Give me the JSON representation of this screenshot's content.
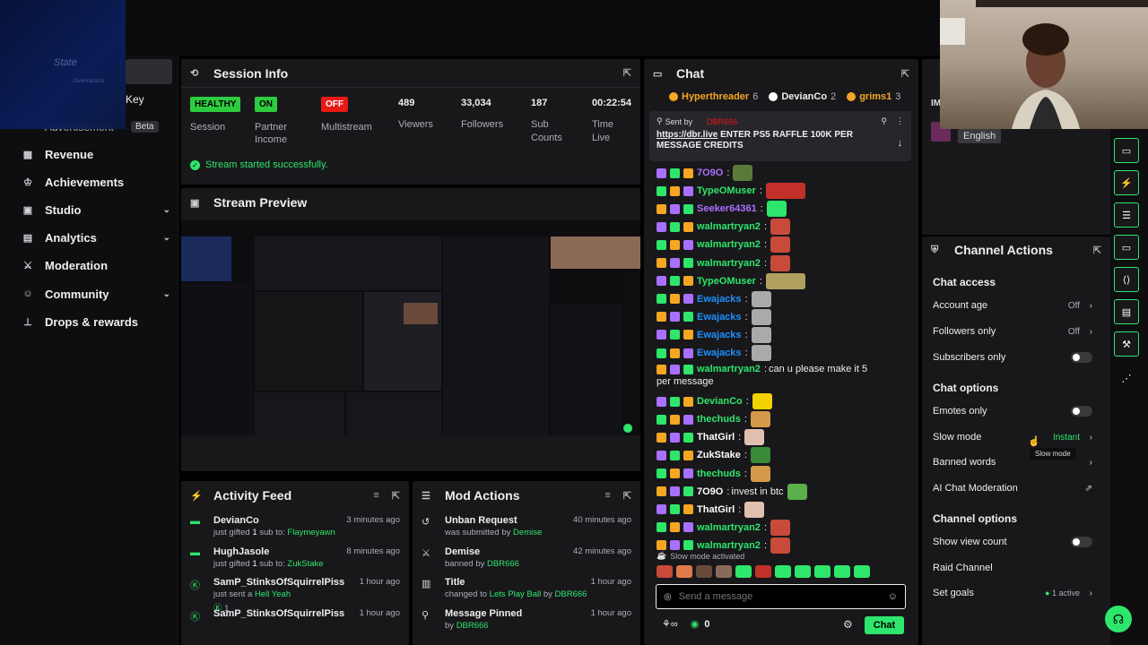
{
  "overlay": {
    "text1": "State",
    "text2": "Overmedium"
  },
  "sidebar": {
    "key_label": "Key",
    "adv_label": "Advertisement",
    "beta": "Beta",
    "items": [
      {
        "label": "Revenue",
        "icon": "revenue-icon",
        "glyph": "▦",
        "chevron": false
      },
      {
        "label": "Achievements",
        "icon": "trophy-icon",
        "glyph": "♔",
        "chevron": false
      },
      {
        "label": "Studio",
        "icon": "studio-icon",
        "glyph": "▣",
        "chevron": true
      },
      {
        "label": "Analytics",
        "icon": "analytics-icon",
        "glyph": "▤",
        "chevron": true
      },
      {
        "label": "Moderation",
        "icon": "sword-icon",
        "glyph": "⚔",
        "chevron": false
      },
      {
        "label": "Community",
        "icon": "community-icon",
        "glyph": "☺",
        "chevron": true
      },
      {
        "label": "Drops & rewards",
        "icon": "drops-icon",
        "glyph": "⊥",
        "chevron": false
      }
    ]
  },
  "session": {
    "title": "Session Info",
    "stats": [
      {
        "badge": "HEALTHY",
        "badge_color": "green",
        "label": "Session"
      },
      {
        "badge": "ON",
        "badge_color": "green",
        "label": "Partner\nIncome"
      },
      {
        "badge": "OFF",
        "badge_color": "red",
        "label": "Multistream"
      },
      {
        "value": "489",
        "label": "Viewers"
      },
      {
        "value": "33,034",
        "label": "Followers"
      },
      {
        "value": "187",
        "label": "Sub\nCounts"
      },
      {
        "value": "00:22:54",
        "label": "Time\nLive"
      }
    ],
    "success": "Stream started successfully."
  },
  "preview": {
    "title": "Stream Preview"
  },
  "activity": {
    "title": "Activity Feed",
    "rows": [
      {
        "name": "DevianCo",
        "pre": "just gifted ",
        "num": "1",
        "mid": " sub to: ",
        "target": "Flaymeyawn",
        "time": "3 minutes ago",
        "icon": "gift-icon",
        "glyph": "▬"
      },
      {
        "name": "HughJasole",
        "pre": "just gifted ",
        "num": "1",
        "mid": " sub to: ",
        "target": "ZukStake",
        "time": "8 minutes ago",
        "icon": "gift-icon",
        "glyph": "▬"
      },
      {
        "name": "SamP_StinksOfSquirrelPiss",
        "pre": "just sent a ",
        "num": "",
        "mid": "",
        "target": "Hell Yeah",
        "time": "1 hour ago",
        "icon": "kick-icon",
        "glyph": "Ⓚ",
        "extra": "1"
      },
      {
        "name": "SamP_StinksOfSquirrelPiss",
        "pre": "",
        "num": "",
        "mid": "",
        "target": "",
        "time": "1 hour ago",
        "icon": "kick-icon",
        "glyph": "Ⓚ"
      }
    ]
  },
  "mod": {
    "title": "Mod Actions",
    "rows": [
      {
        "name": "Unban Request",
        "pre": "was submitted by ",
        "target": "Demise",
        "time": "40 minutes ago",
        "icon": "undo-icon",
        "glyph": "↺"
      },
      {
        "name": "Demise",
        "pre": "banned by ",
        "target": "DBR666",
        "time": "42 minutes ago",
        "icon": "ban-icon",
        "glyph": "⚔"
      },
      {
        "name": "Title",
        "pre": "changed to ",
        "mid": "Lets Play Ball",
        "post": " by ",
        "target": "DBR666",
        "time": "1 hour ago",
        "icon": "title-icon",
        "glyph": "▥"
      },
      {
        "name": "Message Pinned",
        "pre": "by ",
        "target": "DBR666",
        "time": "1 hour ago",
        "icon": "pin-icon",
        "glyph": "⚲"
      }
    ]
  },
  "chat": {
    "title": "Chat",
    "leaders": [
      {
        "name": "Hyperthreader",
        "count": "6",
        "color": "#f5a623"
      },
      {
        "name": "DevianCo",
        "count": "2",
        "color": "#ffffff"
      },
      {
        "name": "grims1",
        "count": "3",
        "color": "#f5a623"
      }
    ],
    "pinned": {
      "sent_by": "Sent by",
      "user": "DBR666",
      "link": "https://dbr.live",
      "text": " ENTER PS5 RAFFLE 100K PER MESSAGE CREDITS"
    },
    "messages": [
      {
        "user": "7O9O",
        "color": "#a970ff",
        "text": "",
        "emote": "#5a7a3a"
      },
      {
        "user": "TypeOMuser",
        "color": "#2ee66b",
        "text": "",
        "emote": "#c2302a",
        "wide": true
      },
      {
        "user": "Seeker64361",
        "color": "#a970ff",
        "text": "",
        "emote": "#2ee66b"
      },
      {
        "user": "walmartryan2",
        "color": "#2ee66b",
        "text": "",
        "emote": "#c84a3a"
      },
      {
        "user": "walmartryan2",
        "color": "#2ee66b",
        "text": "",
        "emote": "#c84a3a"
      },
      {
        "user": "walmartryan2",
        "color": "#2ee66b",
        "text": "",
        "emote": "#c84a3a"
      },
      {
        "user": "TypeOMuser",
        "color": "#2ee66b",
        "text": "",
        "emote": "#b0a060",
        "wide": true
      },
      {
        "user": "Ewajacks",
        "color": "#1e90ff",
        "text": "",
        "emote": "#aaa"
      },
      {
        "user": "Ewajacks",
        "color": "#1e90ff",
        "text": "",
        "emote": "#aaa"
      },
      {
        "user": "Ewajacks",
        "color": "#1e90ff",
        "text": "",
        "emote": "#aaa"
      },
      {
        "user": "Ewajacks",
        "color": "#1e90ff",
        "text": "",
        "emote": "#aaa"
      },
      {
        "user": "walmartryan2",
        "color": "#2ee66b",
        "text": "can u please make it 5",
        "text2": "per message"
      },
      {
        "user": "DevianCo",
        "color": "#2ee66b",
        "text": "",
        "emote": "#f2d200"
      },
      {
        "user": "thechuds",
        "color": "#2ee66b",
        "text": "",
        "emote": "#d49a4a"
      },
      {
        "user": "ThatGirl",
        "color": "#ffffff",
        "text": "",
        "emote": "#e0c0b0"
      },
      {
        "user": "ZukStake",
        "color": "#ffffff",
        "text": "",
        "emote": "#3a8a3a"
      },
      {
        "user": "thechuds",
        "color": "#2ee66b",
        "text": "",
        "emote": "#d49a4a"
      },
      {
        "user": "7O9O",
        "color": "#ffffff",
        "text": "invest in btc",
        "emote": "#5ab04a"
      },
      {
        "user": "ThatGirl",
        "color": "#ffffff",
        "text": "",
        "emote": "#e0c0b0"
      },
      {
        "user": "walmartryan2",
        "color": "#2ee66b",
        "text": "",
        "emote": "#c84a3a"
      },
      {
        "user": "walmartryan2",
        "color": "#2ee66b",
        "text": "",
        "emote": "#c84a3a"
      }
    ],
    "slow_notice": "Slow mode activated",
    "input_placeholder": "Send a message",
    "points": "0",
    "send_label": "Chat"
  },
  "camera": {
    "lang": "English"
  },
  "actions": {
    "title": "Channel Actions",
    "sections": {
      "access": "Chat access",
      "options": "Chat options",
      "channel": "Channel options"
    },
    "account_age": {
      "label": "Account age",
      "value": "Off"
    },
    "followers_only": {
      "label": "Followers only",
      "value": "Off"
    },
    "subscribers_only": {
      "label": "Subscribers only"
    },
    "emotes_only": {
      "label": "Emotes only"
    },
    "slow_mode": {
      "label": "Slow mode",
      "value": "Instant",
      "tooltip": "Slow mode"
    },
    "banned_words": {
      "label": "Banned words"
    },
    "ai_mod": {
      "label": "AI Chat Moderation"
    },
    "view_count": {
      "label": "Show view count"
    },
    "raid": {
      "label": "Raid Channel"
    },
    "goals": {
      "label": "Set goals",
      "value": "1 active"
    }
  }
}
